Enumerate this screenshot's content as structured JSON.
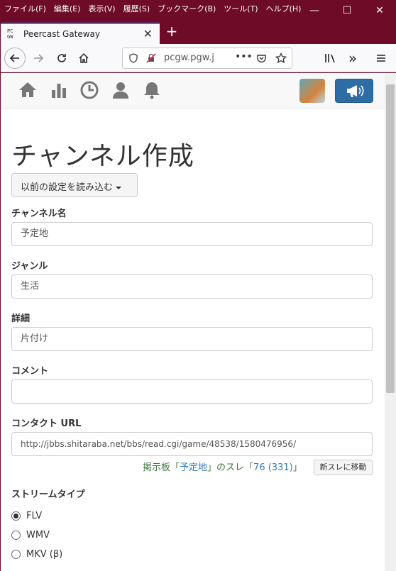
{
  "menu": [
    "ファイル(F)",
    "編集(E)",
    "表示(V)",
    "履歴(S)",
    "ブックマーク(B)",
    "ツール(T)",
    "ヘルプ(H)"
  ],
  "window_controls": {
    "minimize": "—",
    "maximize": "☐",
    "close": "✕"
  },
  "tab": {
    "favicon": "PC GW",
    "title": "Peercast Gateway",
    "close": "✕"
  },
  "new_tab": "+",
  "url": {
    "text": "pcgw.pgw.j"
  },
  "page": {
    "title": "チャンネル作成",
    "load_button": "以前の設定を読み込む",
    "fields": {
      "channel_name": {
        "label": "チャンネル名",
        "value": "予定地"
      },
      "genre": {
        "label": "ジャンル",
        "value": "生活"
      },
      "detail": {
        "label": "詳細",
        "value": "片付け"
      },
      "comment": {
        "label": "コメント",
        "value": ""
      },
      "contact_url": {
        "label": "コンタクト URL",
        "value": "http://jbbs.shitaraba.net/bbs/read.cgi/game/48538/1580476956/"
      }
    },
    "thread": {
      "prefix": "掲示板「",
      "board": "予定地",
      "middle": "」のスレ「",
      "thread": "76 (331)",
      "suffix": "」",
      "button": "新スレに移動"
    },
    "stream_type": {
      "label": "ストリームタイプ",
      "options": [
        {
          "label": "FLV",
          "checked": true
        },
        {
          "label": "WMV",
          "checked": false
        },
        {
          "label": "MKV (β)",
          "checked": false
        }
      ]
    }
  },
  "colors": {
    "titlebar": "#6e0b26",
    "tab_accent": "#0a84ff",
    "primary_button": "#2e6da4",
    "success_text": "#3c763d",
    "link": "#337ab7"
  }
}
